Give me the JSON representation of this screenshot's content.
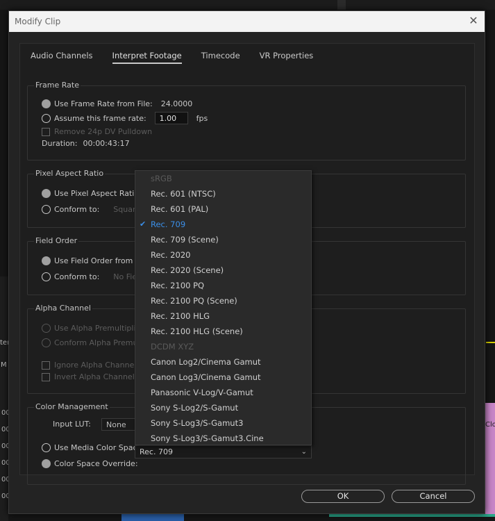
{
  "window": {
    "title": "Modify Clip"
  },
  "tabs": [
    {
      "label": "Audio Channels"
    },
    {
      "label": "Interpret Footage"
    },
    {
      "label": "Timecode"
    },
    {
      "label": "VR Properties"
    }
  ],
  "frame_rate": {
    "title": "Frame Rate",
    "use_file_label": "Use Frame Rate from File:",
    "file_value": "24.0000",
    "assume_label": "Assume this frame rate:",
    "assume_value": "1.00",
    "fps_unit": "fps",
    "pulldown_label": "Remove 24p DV Pulldown",
    "duration_label": "Duration:",
    "duration_value": "00:00:43:17"
  },
  "pixel_aspect": {
    "title": "Pixel Aspect Ratio",
    "use_file_label": "Use Pixel Aspect Ratio fr",
    "conform_label": "Conform to:",
    "conform_value": "Square P"
  },
  "field_order": {
    "title": "Field Order",
    "use_file_label": "Use Field Order from File",
    "conform_label": "Conform to:",
    "conform_value": "No Field"
  },
  "alpha": {
    "title": "Alpha Channel",
    "use_premult_label": "Use Alpha Premultiplica",
    "conform_premult_label": "Conform Alpha Premultipl",
    "ignore_label": "Ignore Alpha Channel",
    "invert_label": "Invert Alpha Channel"
  },
  "color_mgmt": {
    "title": "Color Management",
    "input_lut_label": "Input LUT:",
    "input_lut_value": "None",
    "media_cs_label": "Use Media Color Space f",
    "override_label": "Color Space Override:",
    "override_value": "Rec. 709"
  },
  "dropdown": {
    "items": [
      {
        "label": "sRGB",
        "state": "disabled"
      },
      {
        "label": "Rec. 601 (NTSC)",
        "state": "normal"
      },
      {
        "label": "Rec. 601 (PAL)",
        "state": "normal"
      },
      {
        "label": "Rec. 709",
        "state": "selected"
      },
      {
        "label": "Rec. 709 (Scene)",
        "state": "normal"
      },
      {
        "label": "Rec. 2020",
        "state": "normal"
      },
      {
        "label": "Rec. 2020 (Scene)",
        "state": "normal"
      },
      {
        "label": "Rec. 2100 PQ",
        "state": "normal"
      },
      {
        "label": "Rec. 2100 PQ (Scene)",
        "state": "normal"
      },
      {
        "label": "Rec. 2100 HLG",
        "state": "normal"
      },
      {
        "label": "Rec. 2100 HLG (Scene)",
        "state": "normal"
      },
      {
        "label": "DCDM XYZ",
        "state": "disabled"
      },
      {
        "label": "Canon Log2/Cinema Gamut",
        "state": "normal"
      },
      {
        "label": "Canon Log3/Cinema Gamut",
        "state": "normal"
      },
      {
        "label": "Panasonic V-Log/V-Gamut",
        "state": "normal"
      },
      {
        "label": "Sony S-Log2/S-Gamut",
        "state": "normal"
      },
      {
        "label": "Sony S-Log3/S-Gamut3",
        "state": "normal"
      },
      {
        "label": "Sony S-Log3/S-Gamut3.Cine",
        "state": "normal"
      }
    ]
  },
  "buttons": {
    "ok": "OK",
    "cancel": "Cancel"
  },
  "background": {
    "left_a": "ter",
    "left_b": "M",
    "left_codes": [
      "00",
      "00",
      "00",
      "00",
      "00",
      "00"
    ],
    "right_clip": "Clo"
  },
  "colors": {
    "accent_blue": "#3b8fe8",
    "dialog_bg": "#232323",
    "titlebar_bg": "#f3f3f3",
    "clip_pink": "#c886c8",
    "clip_green": "#2aa88a"
  }
}
